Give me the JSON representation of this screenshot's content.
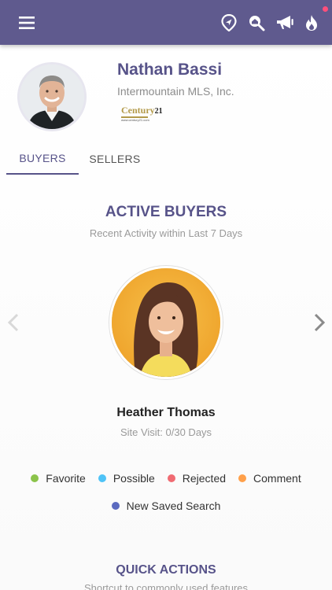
{
  "agent": {
    "name": "Nathan Bassi",
    "organization": "Intermountain MLS, Inc.",
    "brand": {
      "top": "Century",
      "number": "21",
      "small": "www.century21.com"
    }
  },
  "tabs": [
    {
      "label": "BUYERS",
      "active": true
    },
    {
      "label": "SELLERS",
      "active": false
    }
  ],
  "active_buyers": {
    "title": "ACTIVE BUYERS",
    "subtitle": "Recent Activity within Last 7 Days",
    "buyer": {
      "name": "Heather Thomas",
      "site_visit": "Site Visit: 0/30 Days"
    }
  },
  "legend": [
    {
      "label": "Favorite",
      "color": "#8bc34a"
    },
    {
      "label": "Possible",
      "color": "#4fc3f7"
    },
    {
      "label": "Rejected",
      "color": "#f06b72"
    },
    {
      "label": "Comment",
      "color": "#ffa04a"
    },
    {
      "label": "New Saved Search",
      "color": "#5c6bc0"
    }
  ],
  "quick_actions": {
    "title": "QUICK ACTIONS",
    "subtitle": "Shortcut to commonly used features"
  },
  "icons": {
    "menu": "menu-icon",
    "location": "location-pin-icon",
    "search": "search-home-icon",
    "announce": "megaphone-icon",
    "hot": "flame-icon"
  },
  "colors": {
    "brand": "#5f5a8e",
    "accent": "#575389",
    "notification": "#ff4f7b"
  }
}
